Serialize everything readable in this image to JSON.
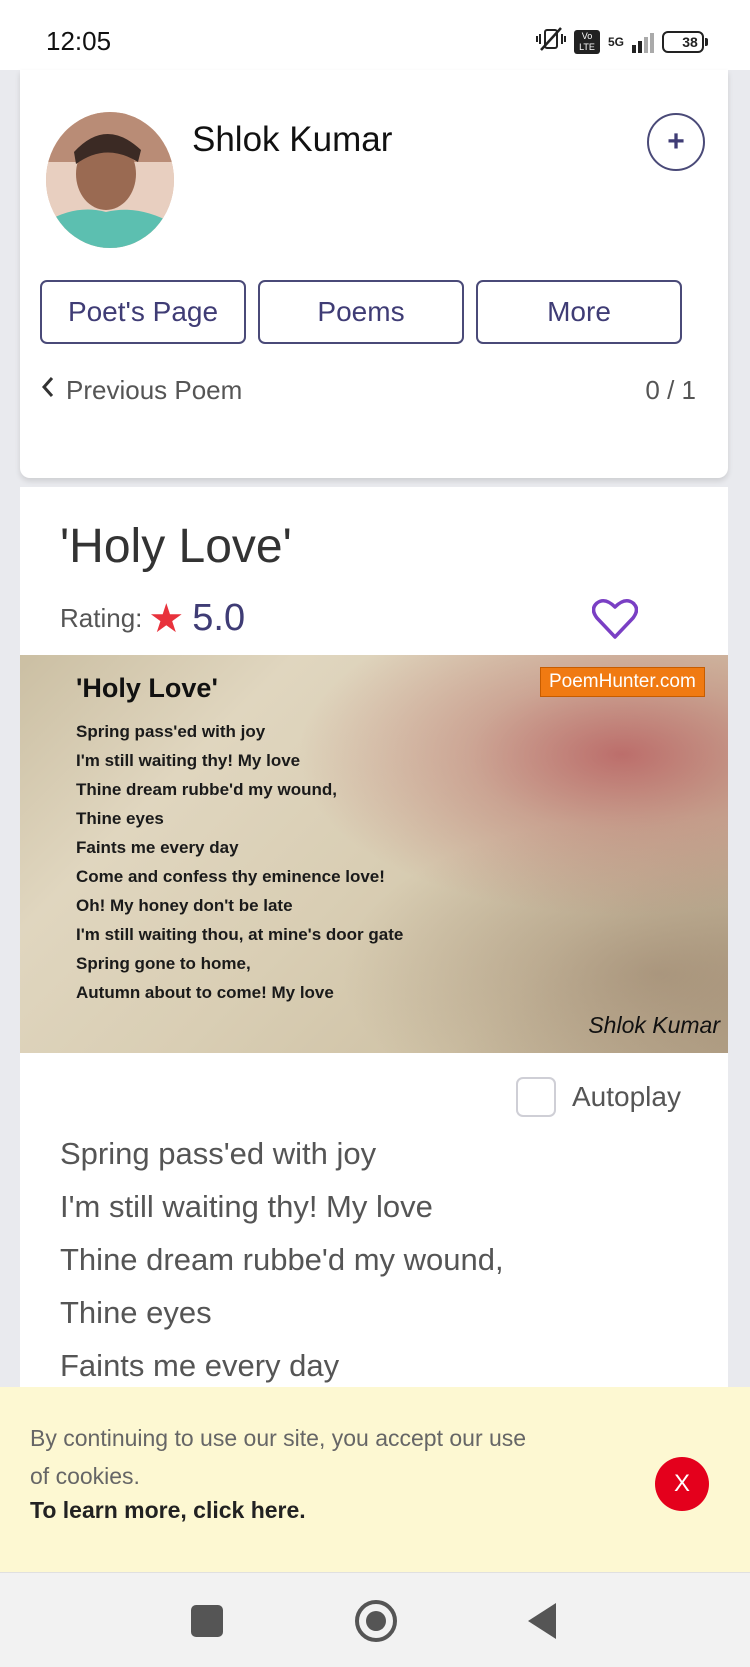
{
  "status_bar": {
    "time": "12:05",
    "volte_label": "Vo LTE",
    "network": "5G",
    "battery": "38"
  },
  "poet": {
    "name": "Shlok Kumar",
    "follow_icon": "+",
    "buttons": [
      "Poet's Page",
      "Poems",
      "More"
    ],
    "previous_label": "Previous Poem",
    "counter": "0 / 1"
  },
  "poem": {
    "title": "'Holy Love'",
    "rating_label": "Rating:",
    "rating_value": "5.0",
    "image": {
      "title": "'Holy Love'",
      "brand": "PoemHunter.com",
      "author": "Shlok Kumar",
      "lines": [
        "Spring pass'ed with joy",
        "I'm still waiting thy! My love",
        "Thine dream rubbe'd my wound,",
        "Thine eyes",
        "Faints me every day",
        "Come and confess thy eminence love!",
        "Oh! My honey don't be late",
        "I'm still waiting thou, at mine's door gate",
        "Spring gone to home,",
        "Autumn about to come! My love"
      ]
    },
    "autoplay_label": "Autoplay",
    "text_lines": [
      "Spring pass'ed with joy",
      "I'm still waiting thy! My love",
      "Thine dream rubbe'd my wound,",
      "Thine eyes",
      "Faints me every day"
    ]
  },
  "cookie": {
    "message": "By continuing to use our site, you accept our use of cookies.",
    "link": "To learn more, click here.",
    "close_label": "X"
  },
  "colors": {
    "accent": "#3f3c75",
    "star": "#e8323c",
    "heart": "#7a3fc4",
    "cookie_bg": "#fdf8d2",
    "close_bg": "#e4001c"
  }
}
